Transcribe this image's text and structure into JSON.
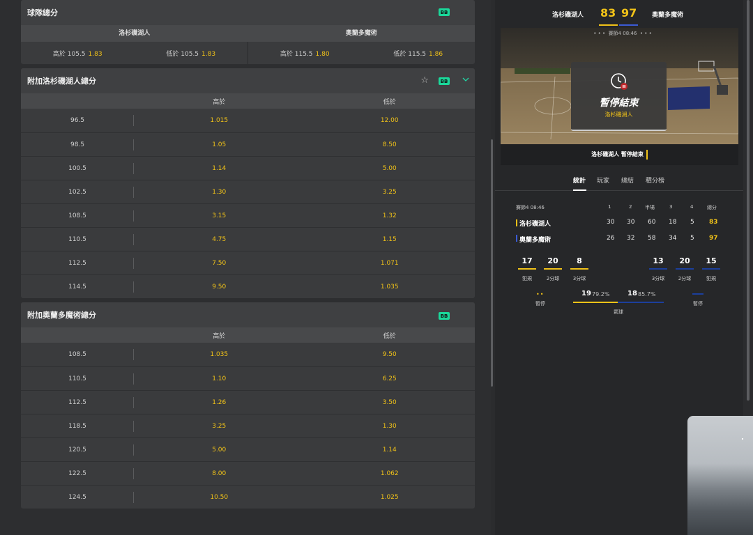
{
  "team_totals": {
    "title": "球隊總分",
    "badge": "BB",
    "teams": [
      "洛杉磯湖人",
      "奧蘭多魔術"
    ],
    "cells": [
      {
        "label": "高於 105.5",
        "odds": "1.83"
      },
      {
        "label": "低於 105.5",
        "odds": "1.83"
      },
      {
        "label": "高於 115.5",
        "odds": "1.80"
      },
      {
        "label": "低於 115.5",
        "odds": "1.86"
      }
    ]
  },
  "lakers_extra": {
    "title": "附加洛杉磯湖人總分",
    "badge": "BB",
    "over_label": "高於",
    "under_label": "低於",
    "rows": [
      {
        "line": "96.5",
        "over": "1.015",
        "under": "12.00"
      },
      {
        "line": "98.5",
        "over": "1.05",
        "under": "8.50"
      },
      {
        "line": "100.5",
        "over": "1.14",
        "under": "5.00"
      },
      {
        "line": "102.5",
        "over": "1.30",
        "under": "3.25"
      },
      {
        "line": "108.5",
        "over": "3.15",
        "under": "1.32"
      },
      {
        "line": "110.5",
        "over": "4.75",
        "under": "1.15"
      },
      {
        "line": "112.5",
        "over": "7.50",
        "under": "1.071"
      },
      {
        "line": "114.5",
        "over": "9.50",
        "under": "1.035"
      }
    ]
  },
  "magic_extra": {
    "title": "附加奧蘭多魔術總分",
    "badge": "BB",
    "over_label": "高於",
    "under_label": "低於",
    "rows": [
      {
        "line": "108.5",
        "over": "1.035",
        "under": "9.50"
      },
      {
        "line": "110.5",
        "over": "1.10",
        "under": "6.25"
      },
      {
        "line": "112.5",
        "over": "1.26",
        "under": "3.50"
      },
      {
        "line": "118.5",
        "over": "3.25",
        "under": "1.30"
      },
      {
        "line": "120.5",
        "over": "5.00",
        "under": "1.14"
      },
      {
        "line": "122.5",
        "over": "8.00",
        "under": "1.062"
      },
      {
        "line": "124.5",
        "over": "10.50",
        "under": "1.025"
      }
    ]
  },
  "scoreboard": {
    "home": "洛杉磯湖人",
    "away": "奧蘭多魔術",
    "home_score": "83",
    "away_score": "97",
    "period_strip": "賽節4 08:46",
    "overlay_title": "暫停結束",
    "overlay_team": "洛杉磯湖人",
    "status": "洛杉磯湖人 暫停結束",
    "colors": {
      "home": "#f2c318",
      "away": "#3b5bd6"
    }
  },
  "tabs": [
    "統計",
    "玩家",
    "總結",
    "積分榜"
  ],
  "stats": {
    "period_label": "賽節4 08:46",
    "headers": [
      "1",
      "2",
      "半場",
      "3",
      "4",
      "總分"
    ],
    "home": {
      "name": "洛杉磯湖人",
      "q": [
        "30",
        "30",
        "60",
        "18",
        "5"
      ],
      "total": "83"
    },
    "away": {
      "name": "奧蘭多魔術",
      "q": [
        "26",
        "32",
        "58",
        "34",
        "5"
      ],
      "total": "97"
    },
    "home_boxes": [
      {
        "value": "17",
        "label": "犯規"
      },
      {
        "value": "20",
        "label": "2分球"
      },
      {
        "value": "8",
        "label": "3分球"
      }
    ],
    "away_boxes": [
      {
        "value": "13",
        "label": "3分球"
      },
      {
        "value": "20",
        "label": "2分球"
      },
      {
        "value": "15",
        "label": "犯規"
      }
    ],
    "timeout_label": "暫停",
    "ft_label": "罰球",
    "home_ft": {
      "value": "19",
      "pct": "79.2%"
    },
    "away_ft": {
      "value": "18",
      "pct": "85.7%"
    }
  }
}
